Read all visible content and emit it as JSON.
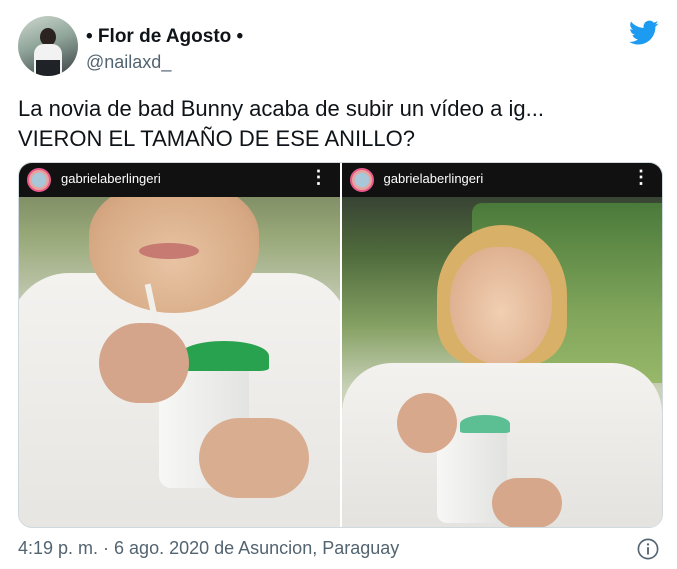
{
  "author": {
    "display_name": "• Flor de Agosto •",
    "handle": "@nailaxd_"
  },
  "tweet": {
    "line1": "La novia de bad Bunny acaba de subir un vídeo a ig...",
    "line2": "VIERON EL TAMAÑO DE ESE ANILLO?"
  },
  "media": [
    {
      "username": "gabrielaberlingeri",
      "more": "⋮"
    },
    {
      "username": "gabrielaberlingeri",
      "more": "⋮"
    }
  ],
  "footer": {
    "timestamp": "4:19 p. m. · 6 ago. 2020 de Asuncion, Paraguay"
  },
  "colors": {
    "brand": "#1d9bf0",
    "text": "#0f1419",
    "muted": "#536471"
  },
  "icons": {
    "brand": "twitter-bird-icon",
    "info": "info-icon",
    "more": "more-vertical-icon"
  }
}
